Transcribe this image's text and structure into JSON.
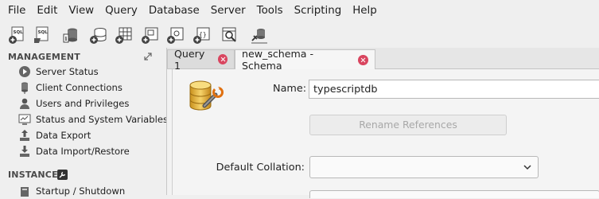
{
  "menu": [
    "File",
    "Edit",
    "View",
    "Query",
    "Database",
    "Server",
    "Tools",
    "Scripting",
    "Help"
  ],
  "toolbar": {
    "buttons": [
      {
        "icon": "new-sql-tab-icon"
      },
      {
        "icon": "open-sql-script-icon"
      },
      {
        "icon": "inspector-icon"
      },
      {
        "icon": "create-schema-icon"
      },
      {
        "icon": "create-table-icon"
      },
      {
        "icon": "create-view-icon"
      },
      {
        "icon": "create-procedure-icon"
      },
      {
        "icon": "create-function-icon"
      },
      {
        "icon": "search-table-data-icon"
      },
      {
        "icon": "reconnect-icon"
      }
    ]
  },
  "sidebar": {
    "management_title": "MANAGEMENT",
    "management_items": [
      {
        "label": "Server Status",
        "icon": "play-circle-icon"
      },
      {
        "label": "Client Connections",
        "icon": "connections-icon"
      },
      {
        "label": "Users and Privileges",
        "icon": "user-icon"
      },
      {
        "label": "Status and System Variables",
        "icon": "monitor-icon"
      },
      {
        "label": "Data Export",
        "icon": "export-icon"
      },
      {
        "label": "Data Import/Restore",
        "icon": "import-icon"
      }
    ],
    "instance_title": "INSTANCE",
    "instance_items": [
      {
        "label": "Startup / Shutdown",
        "icon": "startup-icon"
      }
    ]
  },
  "tabs": [
    {
      "label": "Query 1",
      "active": false
    },
    {
      "label": "new_schema - Schema",
      "active": true
    }
  ],
  "schema_form": {
    "name_label": "Name:",
    "name_value": "typescriptdb",
    "rename_button": "Rename References",
    "collation_label": "Default Collation:",
    "collation_value": ""
  },
  "colors": {
    "close_badge": "#d9455f",
    "background": "#efefef"
  }
}
